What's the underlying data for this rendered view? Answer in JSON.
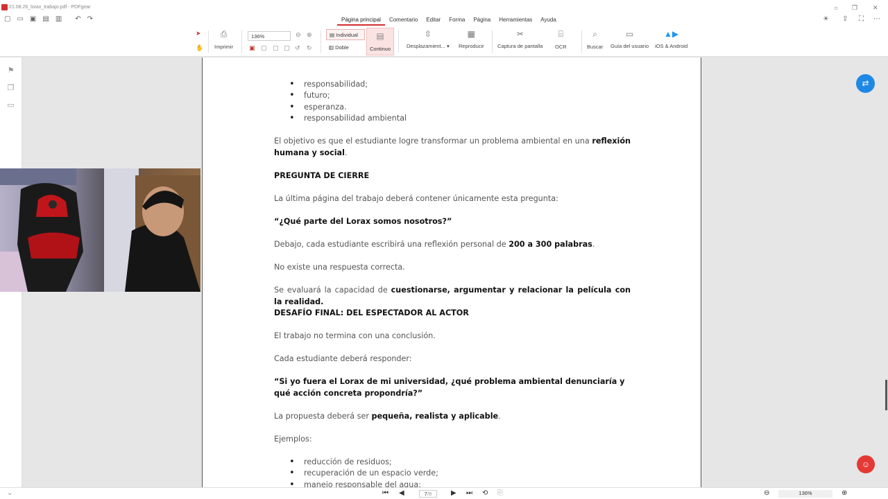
{
  "window": {
    "title": "21.08.26_lorax_trabajo.pdf - PDFgear"
  },
  "menu": {
    "items": [
      "Página principal",
      "Comentario",
      "Editar",
      "Forma",
      "Página",
      "Herramientas",
      "Ayuda"
    ]
  },
  "toolbar": {
    "print": "Imprimir",
    "zoom": "136%",
    "single": "Individual",
    "double": "Doble",
    "continuous": "Continuo",
    "scroll": "Desplazamient...",
    "play": "Reproducir",
    "screenshot": "Captura de pantalla",
    "ocr": "OCR",
    "search": "Buscar",
    "guide": "Guía del usuario",
    "mobile": "iOS & Android"
  },
  "doc": {
    "bullets_top": [
      "responsabilidad;",
      "futuro;",
      "esperanza.",
      "responsabilidad ambiental"
    ],
    "obj_pre": "El objetivo es que el estudiante logre transformar un problema ambiental en una ",
    "obj_bold": "reflexión humana y social",
    "obj_post": ".",
    "h_cierre": "PREGUNTA DE CIERRE",
    "p_ultima": "La última página del trabajo deberá contener únicamente esta pregunta:",
    "q_lorax": "“¿Qué parte del Lorax somos nosotros?”",
    "debajo_pre": "Debajo, cada estudiante escribirá una reflexión personal de ",
    "debajo_bold": "200 a 300 palabras",
    "debajo_post": ".",
    "p_noexiste": "No existe una respuesta correcta.",
    "eval_pre": "Se evaluará la capacidad de ",
    "eval_bold": "cuestionarse, argumentar y relacionar la película con la realidad.",
    "h_desafio": "DESAFÍO FINAL: DEL ESPECTADOR AL ACTOR",
    "p_trabajo": "El trabajo no termina con una conclusión.",
    "p_cada": "Cada estudiante deberá responder:",
    "q_final": "“Si yo fuera el Lorax de mi universidad, ¿qué problema ambiental denunciaría y qué acción concreta propondría?”",
    "prop_pre": "La propuesta deberá ser ",
    "prop_bold": "pequeña, realista y aplicable",
    "prop_post": ".",
    "p_ejemplos": "Ejemplos:",
    "bullets_bottom": [
      "reducción de residuos;",
      "recuperación de un espacio verde;",
      "manejo responsable del agua;"
    ]
  },
  "status": {
    "page": "7",
    "total": "/8",
    "zoom": "136%"
  }
}
